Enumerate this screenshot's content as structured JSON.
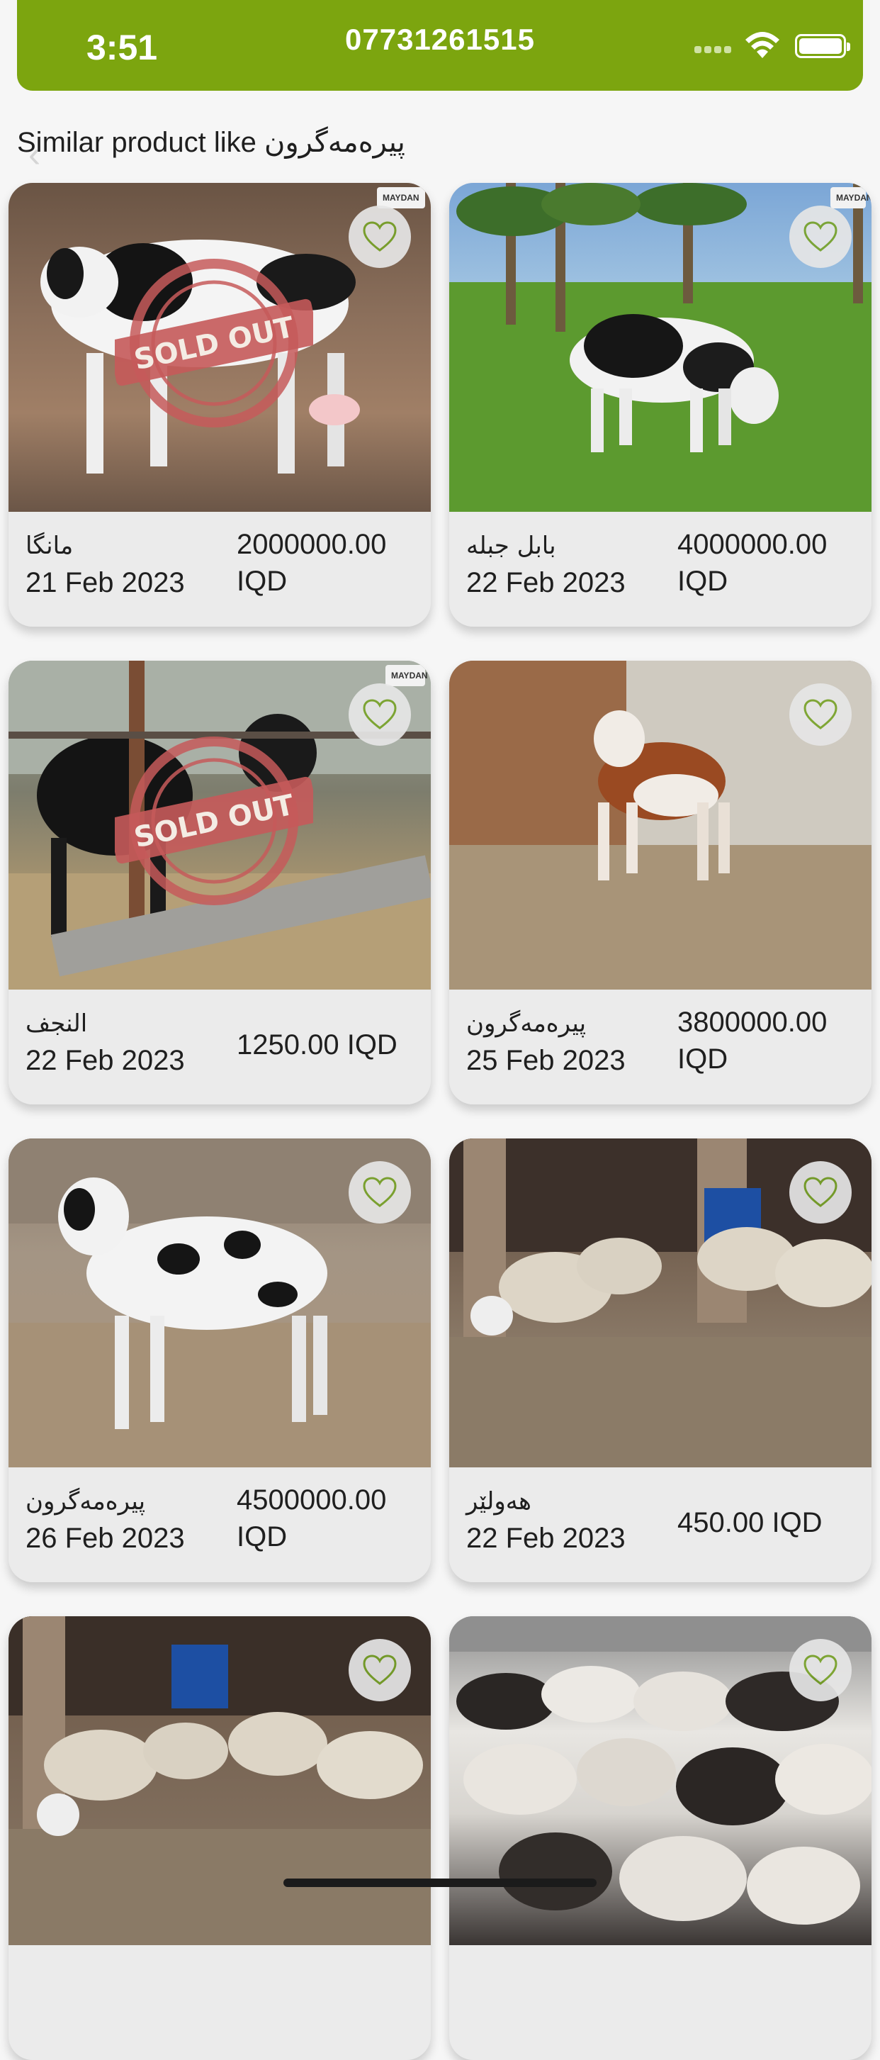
{
  "status_bar": {
    "time": "3:51",
    "phone": "07731261515"
  },
  "section": {
    "title": "Similar product like پیرەمەگرون"
  },
  "products": [
    {
      "name": "مانگا",
      "date": "21 Feb 2023",
      "price": "2000000.00\nIQD",
      "sold_out": true
    },
    {
      "name": "بابل جبله",
      "date": "22 Feb 2023",
      "price": "4000000.00\nIQD",
      "sold_out": false
    },
    {
      "name": "النجف",
      "date": "22 Feb 2023",
      "price": "1250.00 IQD",
      "sold_out": true
    },
    {
      "name": "پیرەمەگرون",
      "date": "25 Feb 2023",
      "price": "3800000.00\nIQD",
      "sold_out": false
    },
    {
      "name": "پیرەمەگرون",
      "date": "26 Feb 2023",
      "price": "4500000.00\nIQD",
      "sold_out": false
    },
    {
      "name": "هەولێر",
      "date": "22 Feb 2023",
      "price": "450.00 IQD",
      "sold_out": false
    }
  ],
  "stamp_text": "SOLD OUT",
  "logo_text": "MAYDAN",
  "colors": {
    "header": "#7ca50f",
    "heart": "#79a32a",
    "stamp": "#c55a5a"
  },
  "icons": {
    "favorite": "heart-outline-icon",
    "back": "chevron-left-icon"
  }
}
